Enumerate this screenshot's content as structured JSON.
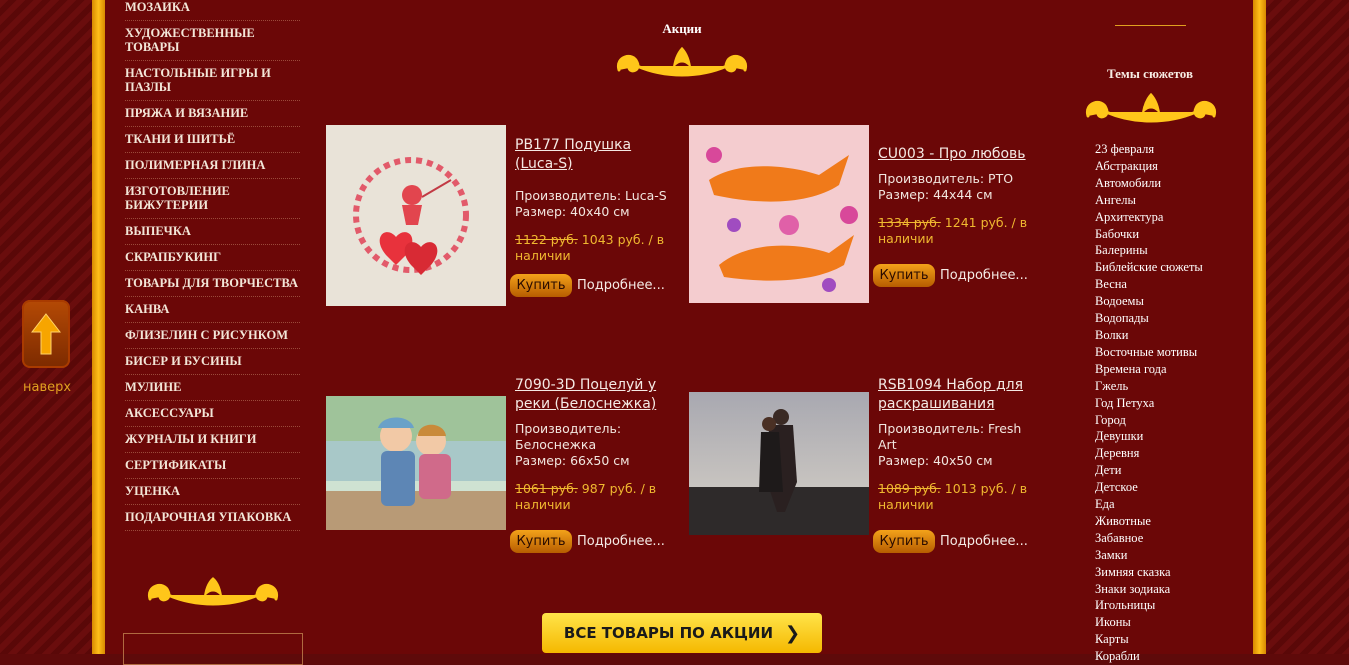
{
  "up_button": {
    "label": "наверх"
  },
  "left_menu": {
    "items": [
      "МОЗАИКА",
      "ХУДОЖЕСТВЕННЫЕ ТОВАРЫ",
      "НАСТОЛЬНЫЕ ИГРЫ И ПАЗЛЫ",
      "ПРЯЖА И ВЯЗАНИЕ",
      "ТКАНИ И ШИТЬЁ",
      "ПОЛИМЕРНАЯ ГЛИНА",
      "ИЗГОТОВЛЕНИЕ БИЖУТЕРИИ",
      "ВЫПЕЧКА",
      "СКРАПБУКИНГ",
      "ТОВАРЫ ДЛЯ ТВОРЧЕСТВА",
      "КАНВА",
      "ФЛИЗЕЛИН С РИСУНКОМ",
      "БИСЕР И БУСИНЫ",
      "МУЛИНЕ",
      "АКСЕССУАРЫ",
      "ЖУРНАЛЫ И КНИГИ",
      "СЕРТИФИКАТЫ",
      "УЦЕНКА",
      "ПОДАРОЧНАЯ УПАКОВКА"
    ]
  },
  "promo": {
    "title": "Акции",
    "all_button": "ВСЕ ТОВАРЫ ПО АКЦИИ",
    "products": [
      {
        "title": "PB177 Подушка (Luca-S)",
        "maker": "Производитель: Luca-S",
        "size": "Размер: 40х40 см",
        "old_price": "1122 руб.",
        "price": " 1043 руб. / в наличии",
        "buy": "Купить",
        "more": "Подробнее...",
        "image": "cupid-hearts-pillow"
      },
      {
        "title": "CU003 - Про любовь",
        "maker": "Производитель: PTO",
        "size": "Размер: 44х44 см",
        "old_price": "1334 руб.",
        "price": " 1241 руб. / в наличии",
        "buy": "Купить",
        "more": "Подробнее...",
        "image": "foxes-pillow"
      },
      {
        "title": "7090-3D Поцелуй у реки (Белоснежка)",
        "maker": "Производитель: Белоснежка",
        "size": "Размер: 66х50 см",
        "old_price": "1061 руб.",
        "price": " 987 руб. / в наличии",
        "buy": "Купить",
        "more": "Подробнее...",
        "image": "kids-kiss-river"
      },
      {
        "title": "RSB1094 Набор для раскрашивания",
        "maker": "Производитель: Fresh Art",
        "size": "Размер: 40х50 см",
        "old_price": "1089 руб.",
        "price": " 1013 руб. / в наличии",
        "buy": "Купить",
        "more": "Подробнее...",
        "image": "couple-beach"
      }
    ]
  },
  "themes": {
    "title": "Темы сюжетов",
    "items": [
      "23 февраля",
      "Абстракция",
      "Автомобили",
      "Ангелы",
      "Архитектура",
      "Бабочки",
      "Балерины",
      "Библейские сюжеты",
      "Весна",
      "Водоемы",
      "Водопады",
      "Волки",
      "Восточные мотивы",
      "Времена года",
      "Гжель",
      "Год Петуха",
      "Город",
      "Девушки",
      "Деревня",
      "Дети",
      "Детское",
      "Еда",
      "Животные",
      "Забавное",
      "Замки",
      "Зимняя сказка",
      "Знаки зодиака",
      "Игольницы",
      "Иконы",
      "Карты",
      "Корабли"
    ]
  },
  "colors": {
    "accent": "#f0b830",
    "background": "#6b0707",
    "gold": "#ffbf1a"
  }
}
